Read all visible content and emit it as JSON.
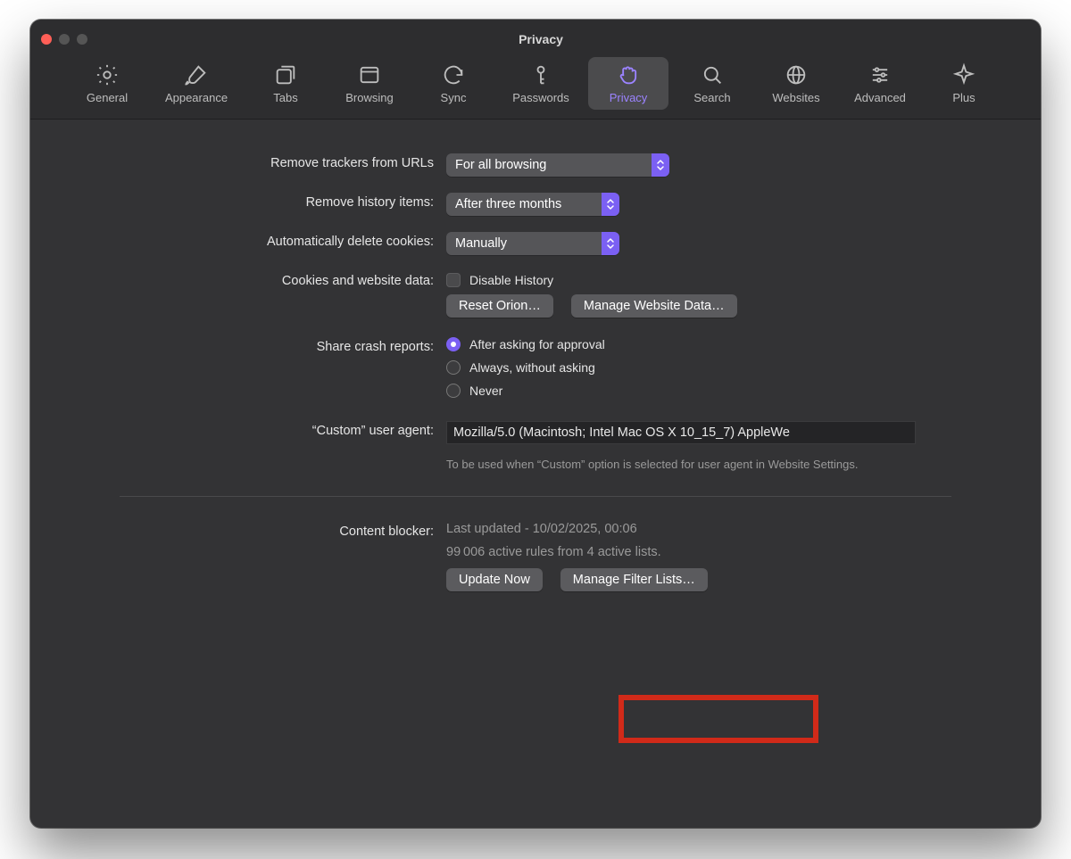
{
  "window": {
    "title": "Privacy"
  },
  "toolbar": {
    "items": [
      {
        "label": "General"
      },
      {
        "label": "Appearance"
      },
      {
        "label": "Tabs"
      },
      {
        "label": "Browsing"
      },
      {
        "label": "Sync"
      },
      {
        "label": "Passwords"
      },
      {
        "label": "Privacy"
      },
      {
        "label": "Search"
      },
      {
        "label": "Websites"
      },
      {
        "label": "Advanced"
      },
      {
        "label": "Plus"
      }
    ],
    "active_index": 6
  },
  "settings": {
    "remove_trackers": {
      "label": "Remove trackers from URLs",
      "value": "For all browsing"
    },
    "remove_history": {
      "label": "Remove history items:",
      "value": "After three months"
    },
    "auto_delete_cookies": {
      "label": "Automatically delete cookies:",
      "value": "Manually"
    },
    "cookies_data": {
      "label": "Cookies and website data:",
      "disable_history_label": "Disable History",
      "reset_button": "Reset Orion…",
      "manage_button": "Manage Website Data…"
    },
    "crash_reports": {
      "label": "Share crash reports:",
      "options": [
        "After asking for approval",
        "Always, without asking",
        "Never"
      ],
      "selected_index": 0
    },
    "user_agent": {
      "label": "“Custom” user agent:",
      "value": "Mozilla/5.0 (Macintosh; Intel Mac OS X 10_15_7) AppleWe",
      "help": "To be used when “Custom” option is selected for user agent in Website Settings."
    },
    "content_blocker": {
      "label": "Content blocker:",
      "last_updated": "Last updated - 10/02/2025, 00:06",
      "active_rules": "99 006 active rules from 4 active lists.",
      "update_button": "Update Now",
      "manage_button": "Manage Filter Lists…"
    }
  }
}
